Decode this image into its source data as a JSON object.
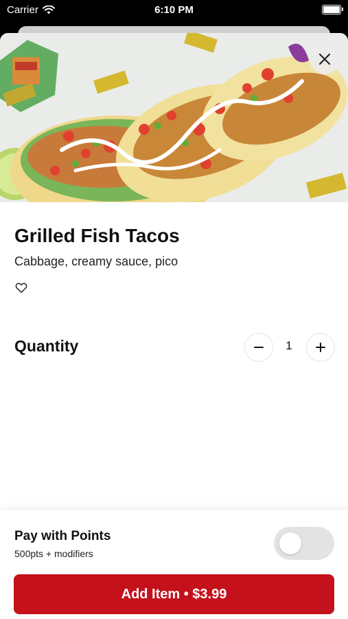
{
  "status_bar": {
    "carrier": "Carrier",
    "time": "6:10 PM"
  },
  "item": {
    "title": "Grilled Fish Tacos",
    "description": "Cabbage, creamy sauce, pico",
    "favorite_icon": "heart-outline-icon",
    "image_icon": "tacos-photo"
  },
  "quantity": {
    "label": "Quantity",
    "value": "1"
  },
  "points": {
    "title": "Pay with Points",
    "subtitle": "500pts + modifiers",
    "enabled": false
  },
  "add_button": {
    "label": "Add Item • $3.99"
  },
  "colors": {
    "accent": "#c4111b",
    "toggle_off": "#e3e3e3"
  }
}
